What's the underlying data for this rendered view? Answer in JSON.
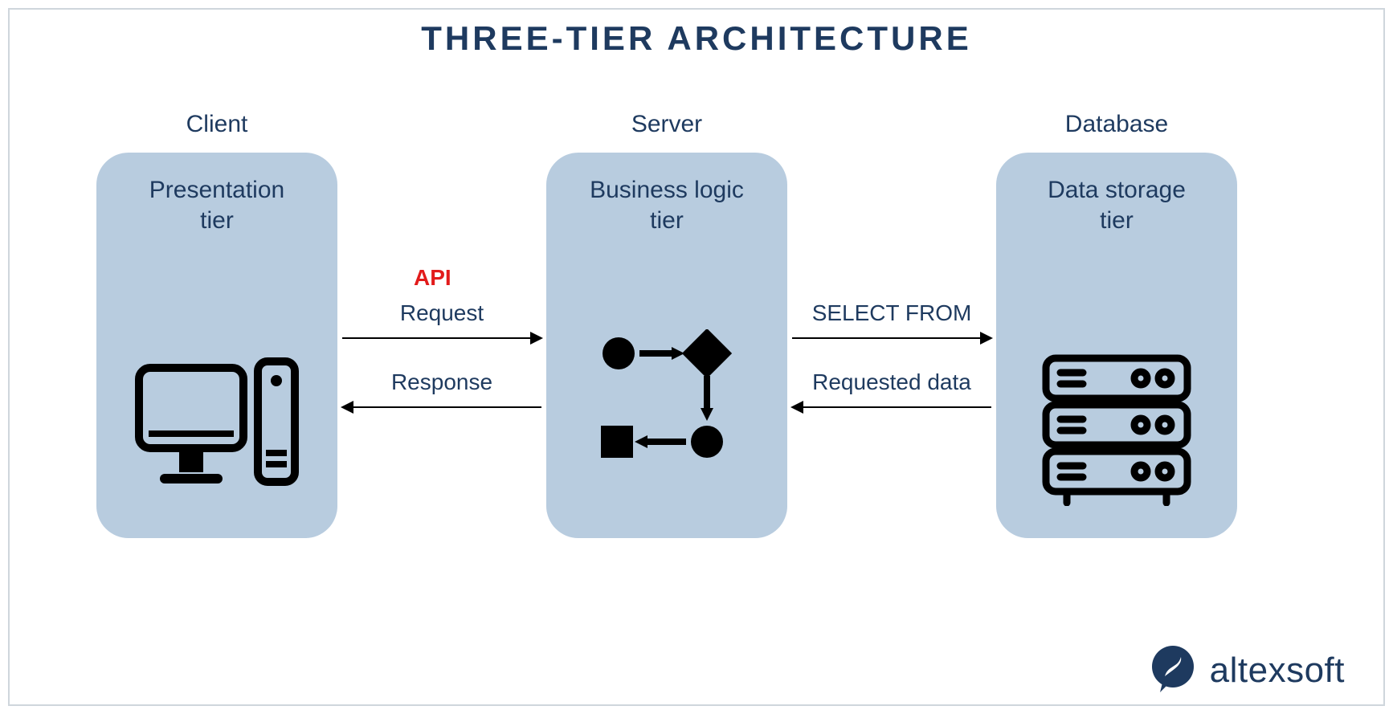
{
  "title": "THREE-TIER ARCHITECTURE",
  "tiers": [
    {
      "label": "Client",
      "name": "Presentation\ntier"
    },
    {
      "label": "Server",
      "name": "Business logic\ntier"
    },
    {
      "label": "Database",
      "name": "Data storage\ntier"
    }
  ],
  "api_label": "API",
  "flows": {
    "client_to_server": "Request",
    "server_to_client": "Response",
    "server_to_database": "SELECT FROM",
    "database_to_server": "Requested data"
  },
  "brand": "altexsoft"
}
